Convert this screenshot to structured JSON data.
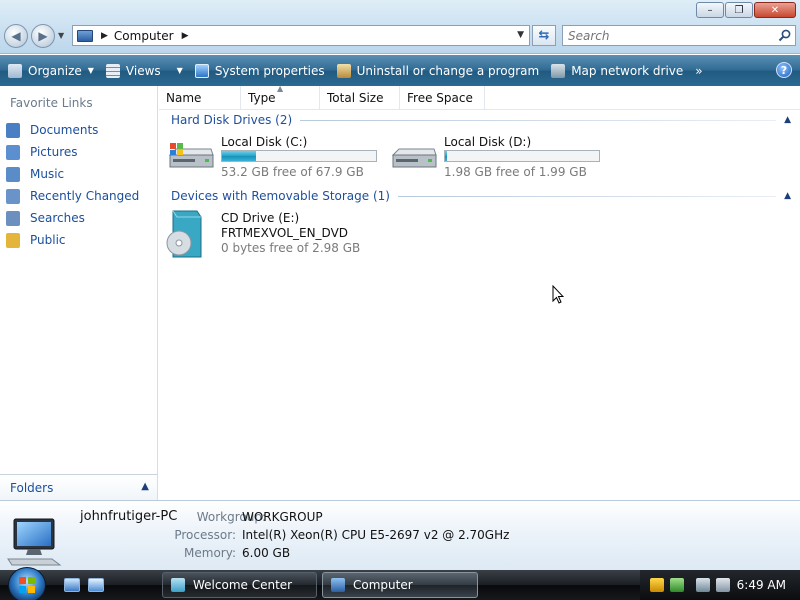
{
  "window": {
    "title": "Computer",
    "minimize_glyph": "–",
    "maximize_glyph": "❐",
    "close_glyph": "✕"
  },
  "address": {
    "path": "Computer",
    "search_placeholder": "Search"
  },
  "toolbar": {
    "organize": "Organize",
    "views": "Views",
    "system_properties": "System properties",
    "uninstall": "Uninstall or change a program",
    "map_network": "Map network drive",
    "overflow": "»",
    "help": "?"
  },
  "navpane": {
    "header": "Favorite Links",
    "items": [
      {
        "label": "Documents",
        "icon": "documents-icon",
        "color": "#4b7fc4"
      },
      {
        "label": "Pictures",
        "icon": "pictures-icon",
        "color": "#5b8fd0"
      },
      {
        "label": "Music",
        "icon": "music-icon",
        "color": "#5a8cc7"
      },
      {
        "label": "Recently Changed",
        "icon": "recently-changed-icon",
        "color": "#6a93c9"
      },
      {
        "label": "Searches",
        "icon": "searches-icon",
        "color": "#6b8fbf"
      },
      {
        "label": "Public",
        "icon": "public-folder-icon",
        "color": "#e3b53a"
      }
    ],
    "folders": "Folders"
  },
  "columns": {
    "name": "Name",
    "type": "Type",
    "total_size": "Total Size",
    "free_space": "Free Space"
  },
  "groups": {
    "hard_disks": "Hard Disk Drives (2)",
    "removable": "Devices with Removable Storage (1)"
  },
  "drives": [
    {
      "name": "Local Disk (C:)",
      "free": "53.2 GB free of 67.9 GB",
      "used_fraction": 0.22
    },
    {
      "name": "Local Disk (D:)",
      "free": "1.98 GB free of 1.99 GB",
      "used_fraction": 0.01
    }
  ],
  "cd": {
    "name": "CD Drive (E:)",
    "label": "FRTMEXVOL_EN_DVD",
    "free": "0 bytes free of 2.98 GB"
  },
  "details": {
    "computer_name": "johnfrutiger-PC",
    "workgroup_label": "Workgroup:",
    "workgroup": "WORKGROUP",
    "processor_label": "Processor:",
    "processor": "Intel(R) Xeon(R) CPU E5-2697 v2 @ 2.70GHz",
    "memory_label": "Memory:",
    "memory": "6.00 GB"
  },
  "taskbar": {
    "tasks": [
      {
        "label": "Welcome Center",
        "active": false
      },
      {
        "label": "Computer",
        "active": true
      }
    ],
    "clock": "6:49 AM"
  }
}
